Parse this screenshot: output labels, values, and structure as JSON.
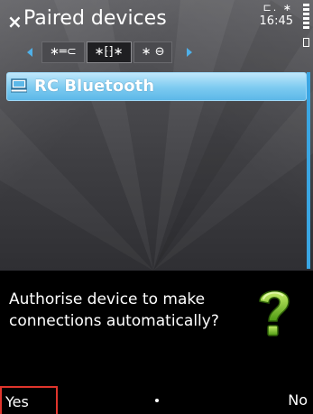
{
  "header": {
    "close_glyph": "×",
    "title": "Paired devices",
    "clock": "16:45",
    "status_icons": "⊏. ∗"
  },
  "tabs": [
    {
      "label": "∗═⊂",
      "icon": "bluetooth-headset-icon",
      "active": false
    },
    {
      "label": "∗⁅⁆∗",
      "icon": "bluetooth-pair-icon",
      "active": true
    },
    {
      "label": "∗ ⊖",
      "icon": "bluetooth-blocked-icon",
      "active": false
    }
  ],
  "list": {
    "items": [
      {
        "label": "RC Bluetooth",
        "icon": "computer-icon"
      }
    ]
  },
  "dialog": {
    "message": "Authorise device to make connections automatically?",
    "icon": "question-icon"
  },
  "softkeys": {
    "left": "Yes",
    "right": "No"
  },
  "colors": {
    "accent": "#4fb0e8",
    "highlight_border": "#e0352c",
    "question_green": "#7ed321"
  }
}
